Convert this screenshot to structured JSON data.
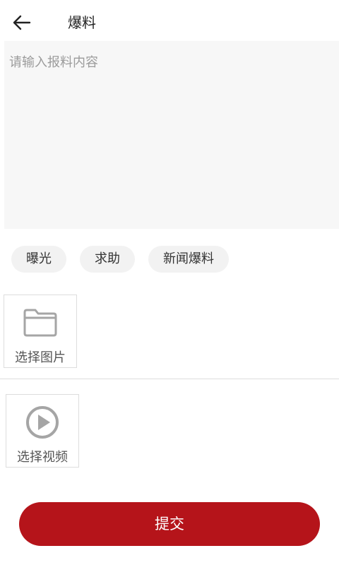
{
  "header": {
    "title": "爆料",
    "back_icon": "arrow-left-icon"
  },
  "content_input": {
    "placeholder": "请输入报料内容",
    "value": ""
  },
  "tags": [
    {
      "label": "曝光"
    },
    {
      "label": "求助"
    },
    {
      "label": "新闻爆料"
    }
  ],
  "image_picker": {
    "label": "选择图片",
    "icon": "folder-icon"
  },
  "video_picker": {
    "label": "选择视频",
    "icon": "play-circle-icon"
  },
  "submit": {
    "label": "提交"
  },
  "colors": {
    "accent": "#b5141a",
    "input_background": "#f7f7f7",
    "tag_background": "#f2f2f2",
    "icon_gray": "#a5a5a5"
  }
}
